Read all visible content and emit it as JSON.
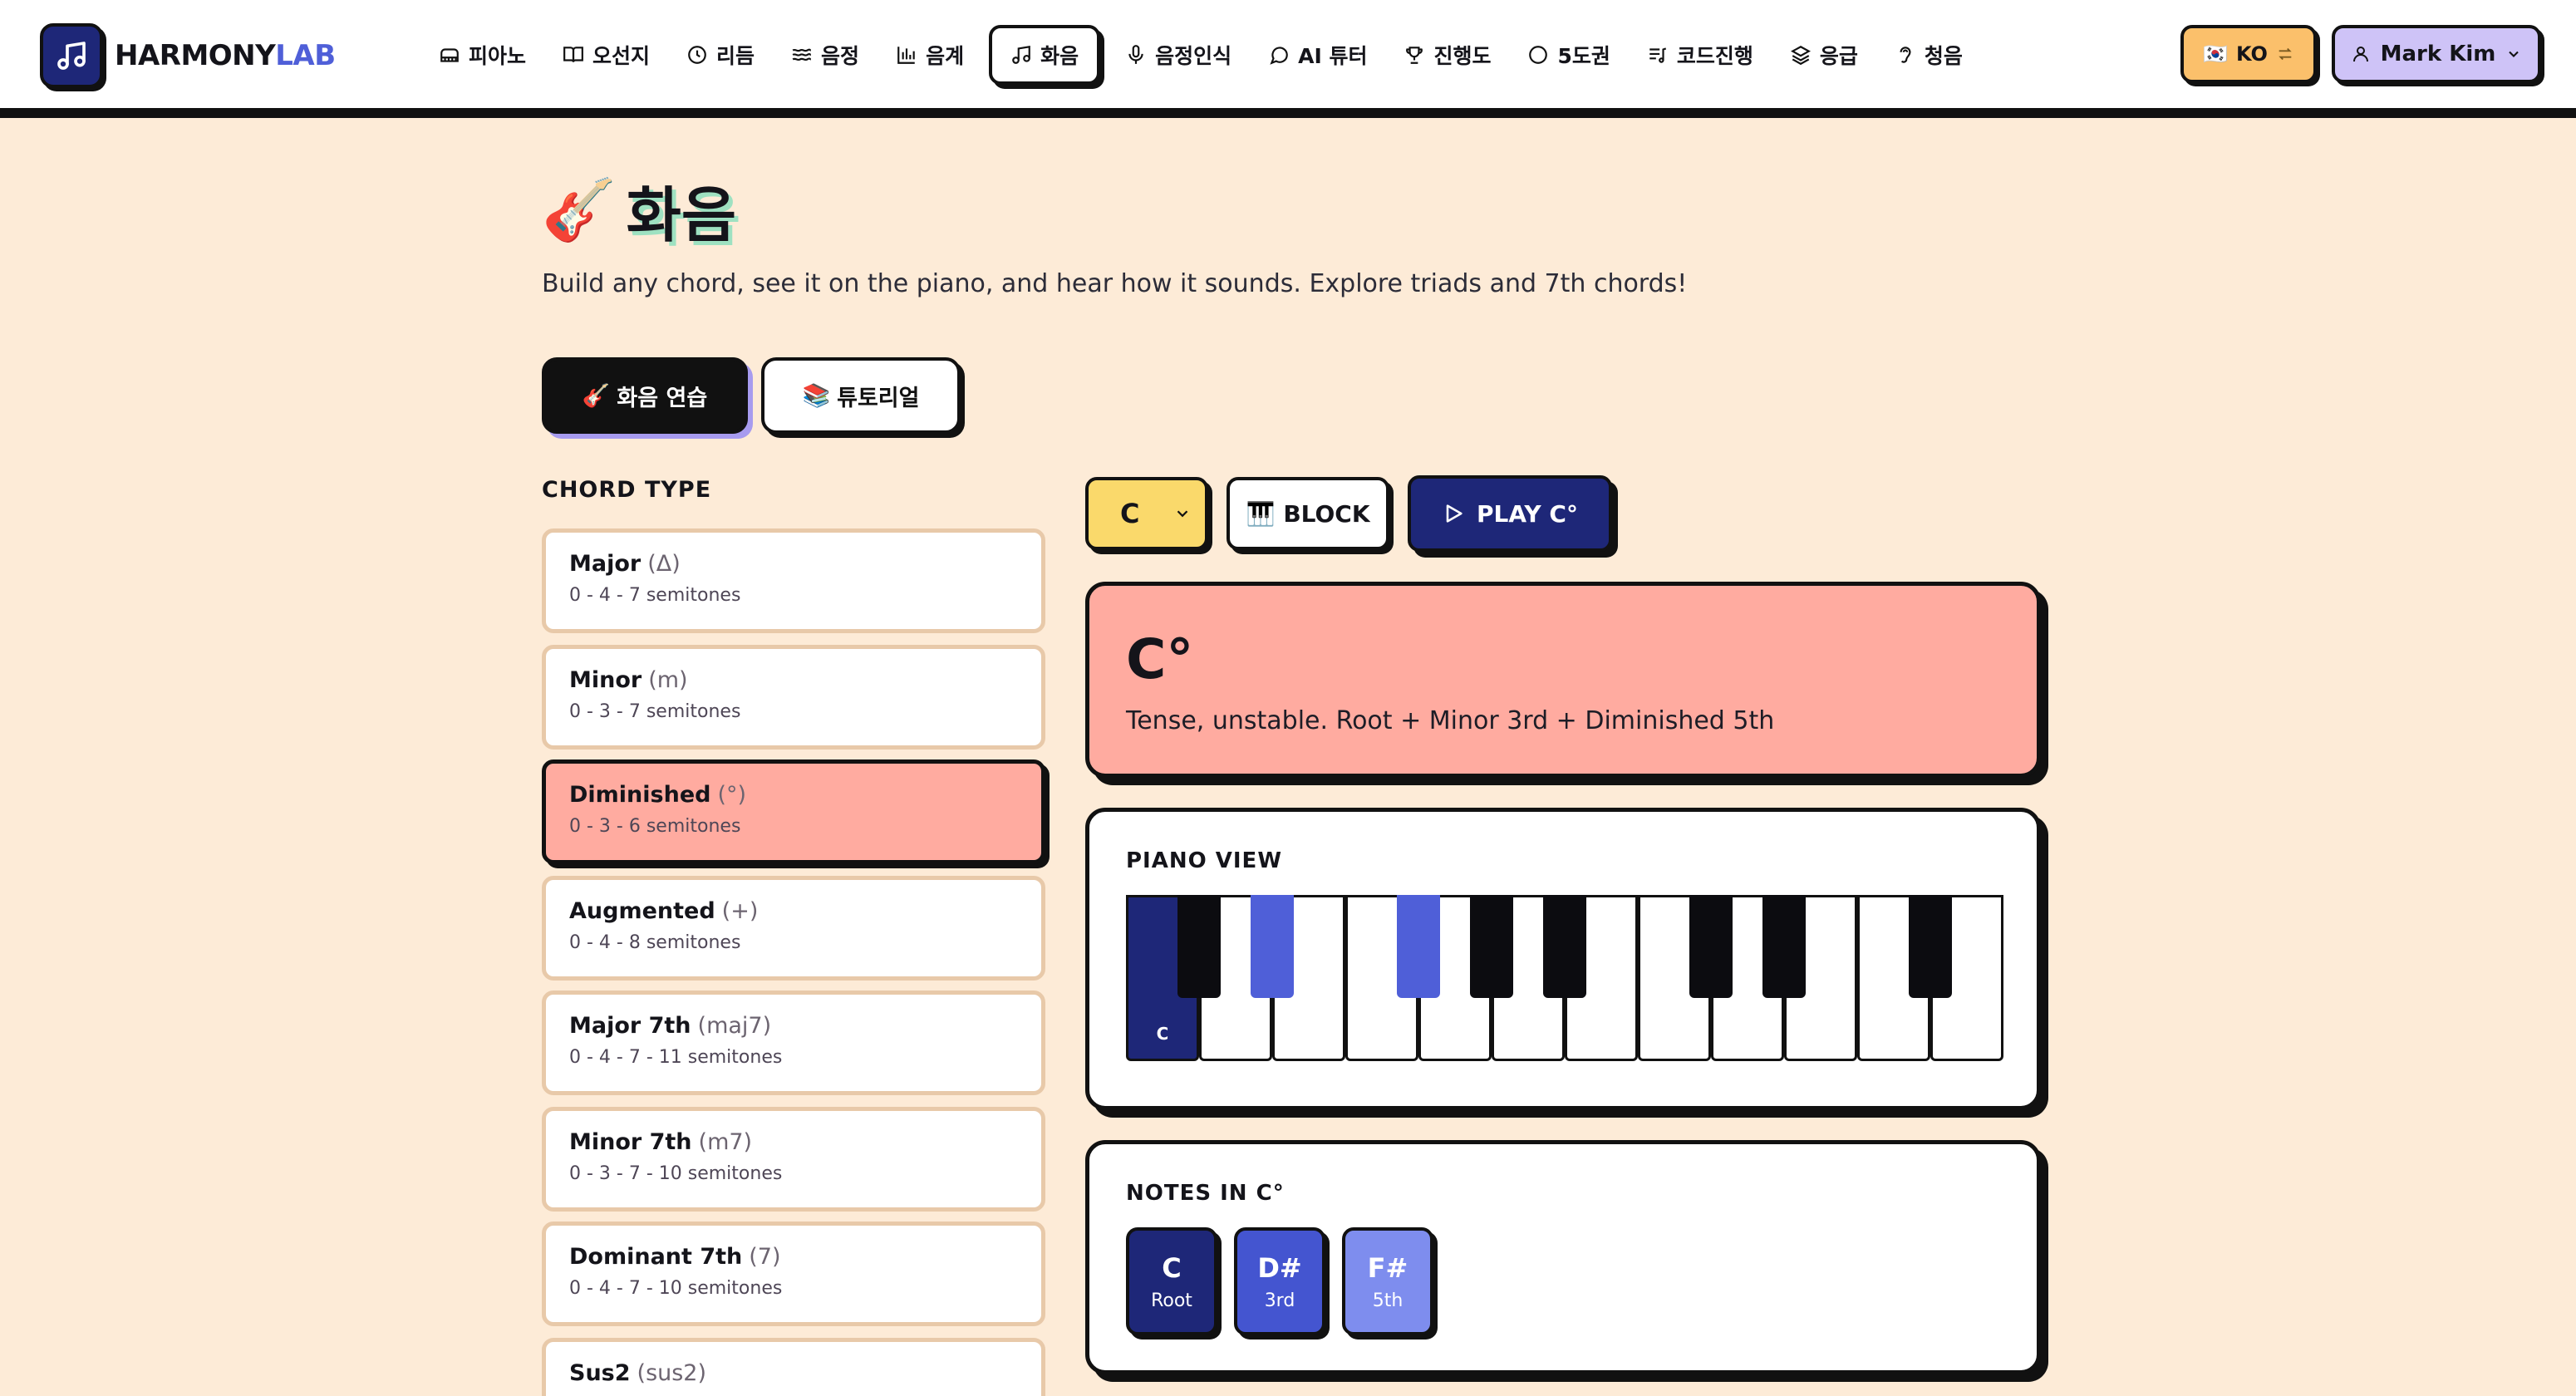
{
  "app": {
    "logo_text_main": "HARMONY",
    "logo_text_accent": "LAB",
    "logo_icon": "music-note-icon"
  },
  "nav": {
    "items": [
      {
        "label": "피아노",
        "icon": "piano-icon"
      },
      {
        "label": "오선지",
        "icon": "book-icon"
      },
      {
        "label": "리듬",
        "icon": "clock-icon"
      },
      {
        "label": "음정",
        "icon": "waves-icon"
      },
      {
        "label": "음계",
        "icon": "bars-icon"
      },
      {
        "label": "화음",
        "icon": "music-note-icon",
        "active": true
      },
      {
        "label": "음정인식",
        "icon": "mic-icon"
      },
      {
        "label": "AI 튜터",
        "icon": "chat-icon"
      },
      {
        "label": "진행도",
        "icon": "trophy-icon"
      },
      {
        "label": "5도권",
        "icon": "circle-icon"
      },
      {
        "label": "코드진행",
        "icon": "list-music-icon"
      },
      {
        "label": "응급",
        "icon": "layers-icon"
      },
      {
        "label": "청음",
        "icon": "ear-icon"
      }
    ]
  },
  "language": {
    "flag": "🇰🇷",
    "label": "KO",
    "icon": "swap-icon"
  },
  "user": {
    "name": "Mark Kim",
    "icon": "user-icon"
  },
  "page": {
    "emoji": "🎸",
    "title": "화음",
    "subtitle": "Build any chord, see it on the piano, and hear how it sounds. Explore triads and 7th chords!",
    "tabs": [
      {
        "emoji": "🎸",
        "label": "화음 연습",
        "active": true
      },
      {
        "emoji": "📚",
        "label": "튜토리얼",
        "active": false
      }
    ]
  },
  "chord_types": {
    "heading": "CHORD TYPE",
    "items": [
      {
        "name": "Major",
        "symbol": "(Δ)",
        "intervals": "0 - 4 - 7 semitones",
        "selected": false
      },
      {
        "name": "Minor",
        "symbol": "(m)",
        "intervals": "0 - 3 - 7 semitones",
        "selected": false
      },
      {
        "name": "Diminished",
        "symbol": "(°)",
        "intervals": "0 - 3 - 6 semitones",
        "selected": true
      },
      {
        "name": "Augmented",
        "symbol": "(+)",
        "intervals": "0 - 4 - 8 semitones",
        "selected": false
      },
      {
        "name": "Major 7th",
        "symbol": "(maj7)",
        "intervals": "0 - 4 - 7 - 11 semitones",
        "selected": false
      },
      {
        "name": "Minor 7th",
        "symbol": "(m7)",
        "intervals": "0 - 3 - 7 - 10 semitones",
        "selected": false
      },
      {
        "name": "Dominant 7th",
        "symbol": "(7)",
        "intervals": "0 - 4 - 7 - 10 semitones",
        "selected": false
      },
      {
        "name": "Sus2",
        "symbol": "(sus2)",
        "intervals": "",
        "selected": false
      }
    ]
  },
  "controls": {
    "root": "C",
    "block_emoji": "🎹",
    "block_label": "BLOCK",
    "play_label": "PLAY C°"
  },
  "chord": {
    "display": "C°",
    "description": "Tense, unstable. Root + Minor 3rd + Diminished 5th"
  },
  "piano": {
    "heading": "PIANO VIEW",
    "white_keys": [
      "C",
      "D",
      "E",
      "F",
      "G",
      "A",
      "B",
      "C",
      "D",
      "E",
      "F",
      "G"
    ],
    "highlighted_white": [
      0
    ],
    "black_keys": [
      "C#",
      "D#",
      "F#",
      "G#",
      "A#",
      "C#",
      "D#",
      "F#"
    ],
    "highlighted_black": [
      1,
      2
    ],
    "label_c": "C"
  },
  "notes": {
    "heading": "NOTES IN C°",
    "items": [
      {
        "note": "C",
        "role": "Root",
        "color": "#1E2778"
      },
      {
        "note": "D#",
        "role": "3rd",
        "color": "#4455D0"
      },
      {
        "note": "F#",
        "role": "5th",
        "color": "#7E8DEE"
      }
    ]
  },
  "colors": {
    "background": "#FDEBD7",
    "selected_chord": "#FFABA0",
    "primary": "#1E2778",
    "accent": "#4F5FD8",
    "root_select": "#FAD96B",
    "lang_button": "#FBC06B",
    "user_button": "#CEC3F7"
  }
}
